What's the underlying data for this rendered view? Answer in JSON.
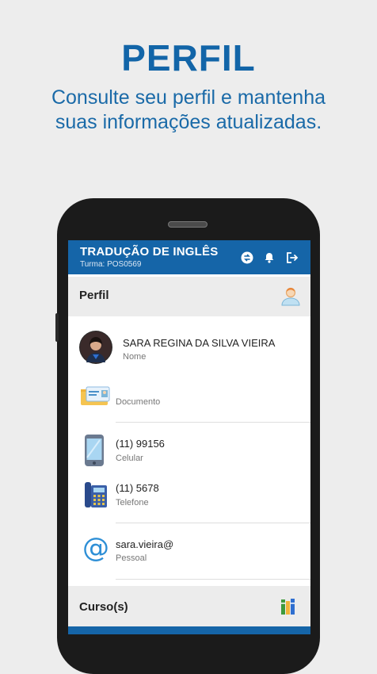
{
  "promo": {
    "title": "PERFIL",
    "subtitle_line1": "Consulte seu perfil e mantenha",
    "subtitle_line2": "suas informações atualizadas."
  },
  "appbar": {
    "title": "TRADUÇÃO DE INGLÊS",
    "subtitle": "Turma: POS0569",
    "icons": [
      "sync-icon",
      "bell-icon",
      "logout-icon"
    ]
  },
  "profile_section": {
    "title": "Perfil",
    "icon": "user-profile-icon"
  },
  "rows": {
    "name": {
      "value": "SARA REGINA DA SILVA VIEIRA",
      "label": "Nome"
    },
    "document": {
      "value": "",
      "label": "Documento"
    },
    "mobile": {
      "value": "(11) 99156",
      "label": "Celular"
    },
    "phone": {
      "value": "(11) 5678",
      "label": "Telefone"
    },
    "email": {
      "value": "sara.vieira@",
      "label": "Pessoal"
    }
  },
  "courses_section": {
    "title": "Curso(s)",
    "icon": "books-icon"
  },
  "colors": {
    "brand_blue": "#1565a8",
    "section_gray": "#ececec"
  }
}
